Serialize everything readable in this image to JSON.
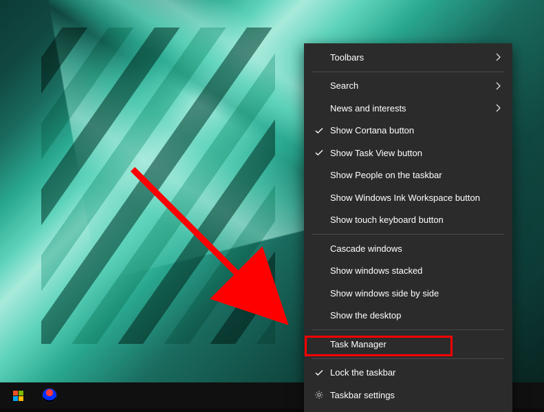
{
  "menu": {
    "items": [
      {
        "label": "Toolbars",
        "has_submenu": true,
        "checked": false
      },
      {
        "label": "Search",
        "has_submenu": true,
        "checked": false
      },
      {
        "label": "News and interests",
        "has_submenu": true,
        "checked": false
      },
      {
        "label": "Show Cortana button",
        "has_submenu": false,
        "checked": true
      },
      {
        "label": "Show Task View button",
        "has_submenu": false,
        "checked": true
      },
      {
        "label": "Show People on the taskbar",
        "has_submenu": false,
        "checked": false
      },
      {
        "label": "Show Windows Ink Workspace button",
        "has_submenu": false,
        "checked": false
      },
      {
        "label": "Show touch keyboard button",
        "has_submenu": false,
        "checked": false
      }
    ],
    "sep1": true,
    "items2": [
      {
        "label": "Cascade windows",
        "has_submenu": false,
        "checked": false
      },
      {
        "label": "Show windows stacked",
        "has_submenu": false,
        "checked": false
      },
      {
        "label": "Show windows side by side",
        "has_submenu": false,
        "checked": false
      },
      {
        "label": "Show the desktop",
        "has_submenu": false,
        "checked": false
      }
    ],
    "sep2": true,
    "items3": [
      {
        "label": "Task Manager",
        "has_submenu": false,
        "checked": false,
        "highlighted": true
      }
    ],
    "sep3": true,
    "items4": [
      {
        "label": "Lock the taskbar",
        "has_submenu": false,
        "checked": true
      },
      {
        "label": "Taskbar settings",
        "has_submenu": false,
        "checked": false,
        "icon": "gear"
      }
    ]
  },
  "annotation": {
    "arrow_color": "#ff0000",
    "highlight_color": "#ff0000"
  }
}
